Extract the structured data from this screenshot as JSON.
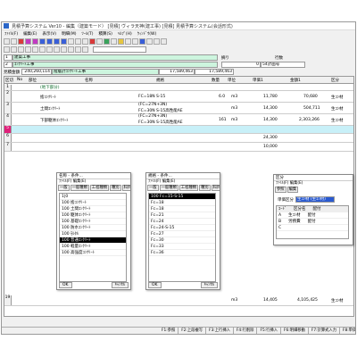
{
  "window": {
    "title": "見積予算システム Ver10 - 編集（建築モード） [見積] ヴィラ天神(建工事) [見積] 見積予算システム(会話形式)"
  },
  "menubar": [
    "ﾌｧｲﾙ(F)",
    "編集(E)",
    "表示(V)",
    "明細(M)",
    "ﾂｰﾙ(T)",
    "積算(S)",
    "ﾍﾙﾌﾟ(H)",
    "ｳｨﾝﾄﾞｳ(W)"
  ],
  "header": {
    "row1_no": "1",
    "row1_text": "建築工事",
    "row2_no": "2",
    "row2_text": "ｺﾝｸﾘｰﾄ工事",
    "label_tsuki": "摘り",
    "label_gyosu": "行数",
    "val_tsuki": "0",
    "val_gyosu": "54計画号",
    "total_label": "見積金額",
    "total_value": "240,260,114",
    "total_name": "階層計ｺﾝｸﾘｰﾄ工事",
    "total_amount1": "17,589,463",
    "total_amount2": "17,589,463"
  },
  "grid": {
    "columns": [
      "区切",
      "No",
      "部位",
      "名称",
      "規格",
      "数量",
      "単位",
      "単価1",
      "金額1",
      "区分"
    ],
    "rows": [
      {
        "no": "1",
        "name": "(地下部分)",
        "spec": "",
        "qty": "",
        "unit": "",
        "price": "",
        "amount": "",
        "cat": ""
      },
      {
        "no": "2",
        "name": "捨ｺﾝｸﾘｰﾄ",
        "spec": "FC=18N S-15",
        "qty": "6.0",
        "unit": "m3",
        "price": "11,780",
        "amount": "70,680",
        "cat": "生ｺﾝ材"
      },
      {
        "no": "3",
        "name": "土間ｺﾝｸﾘｰﾄ",
        "spec": "(FC=27N+3N)",
        "spec2": "FC=30N S-15高性能AE",
        "qty": "",
        "unit": "m3",
        "price": "14,300",
        "amount": "504,711",
        "cat": "生ｺﾝ材"
      },
      {
        "no": "4",
        "name": "下部躯体ｺﾝｸﾘｰﾄ",
        "spec": "(FC=27N+3N)",
        "spec2": "FC=30N S-15高性能AE",
        "qty": "161",
        "unit": "m3",
        "price": "14,300",
        "amount": "2,303,266",
        "cat": "生ｺﾝ材"
      },
      {
        "no": "5",
        "name": "",
        "spec": "",
        "qty": "",
        "unit": "",
        "price": "",
        "amount": "",
        "cat": ""
      },
      {
        "no": "6",
        "name": "",
        "spec": "",
        "qty": "",
        "unit": "",
        "price": "24,300",
        "amount": "",
        "cat": ""
      },
      {
        "no": "7",
        "name": "",
        "spec": "",
        "qty": "",
        "unit": "",
        "price": "10,000",
        "amount": "",
        "cat": ""
      },
      {
        "no": "19",
        "name": "",
        "spec": "",
        "qty": "",
        "unit": "m3",
        "price": "14,405",
        "amount": "4,105,425",
        "cat": "生ｺﾝ材"
      }
    ]
  },
  "popup1": {
    "title": "名称 - 条件...",
    "menu": "ﾌｧｲﾙ(F)  編集(E)",
    "tabs": [
      "一般",
      "一般種類",
      "工程種類",
      "種別",
      "科目"
    ],
    "items": [
      "1|0",
      "100 捨ｺﾝｸﾘｰﾄ",
      "100 土間ｺﾝｸﾘｰﾄ",
      "100 躯体ｺﾝｸﾘｰﾄ",
      "100 基礎ｺﾝｸﾘｰﾄ",
      "100 防水ｺﾝｸﾘｰﾄ",
      "100 ﾓﾙﾀﾙ",
      "100 普通ｺﾝｸﾘｰﾄ",
      "100 軽量ｺﾝｸﾘｰﾄ",
      "100 高強度ｺﾝｸﾘｰﾄ"
    ],
    "selected_index": 7,
    "ok": "OK",
    "cancel": "ｷｬﾝｾﾙ"
  },
  "popup2": {
    "title": "規格 - 条件...",
    "menu": "ﾌｧｲﾙ(F)  編集(E)",
    "tabs": [
      "一般",
      "一般種類",
      "工程種類",
      "種別",
      "科目"
    ],
    "items": [
      "100 Fc=15-S-15",
      "Fc=18",
      "Fc=18",
      "Fc=21",
      "Fc=24",
      "Fc=24-S-15",
      "Fc=27",
      "Fc=30",
      "Fc=33",
      "Fc=36",
      "Fc=21",
      "Fc=24"
    ],
    "selected_index": 0,
    "ok": "OK",
    "cancel": "ｷｬﾝｾﾙ"
  },
  "popup3": {
    "title": "区分",
    "menu": "ﾌｧｲﾙ(F)  編集(E)",
    "tabs": [
      "参照",
      "編集"
    ],
    "field_label": "単価区分",
    "field_value": "生ｺﾝ材 (生ｺﾝ材)",
    "cols": [
      "ｺｰﾄﾞ",
      "区分名",
      "配付"
    ],
    "rows": [
      {
        "code": "A",
        "name": "生ｺﾝ材",
        "note": "配付"
      },
      {
        "code": "B",
        "name": "労務費",
        "note": "配付"
      },
      {
        "code": "C",
        "name": "",
        "note": ""
      },
      {
        "code": "D",
        "name": "",
        "note": ""
      }
    ]
  },
  "statusbar": [
    "F1:参照",
    "F2:上段複写",
    "F3:上行挿入",
    "F4:行削除",
    "F5:行挿入",
    "F6:明細移動",
    "F7:計算式入力",
    "F8:単価複写",
    "F9:金額複写"
  ]
}
